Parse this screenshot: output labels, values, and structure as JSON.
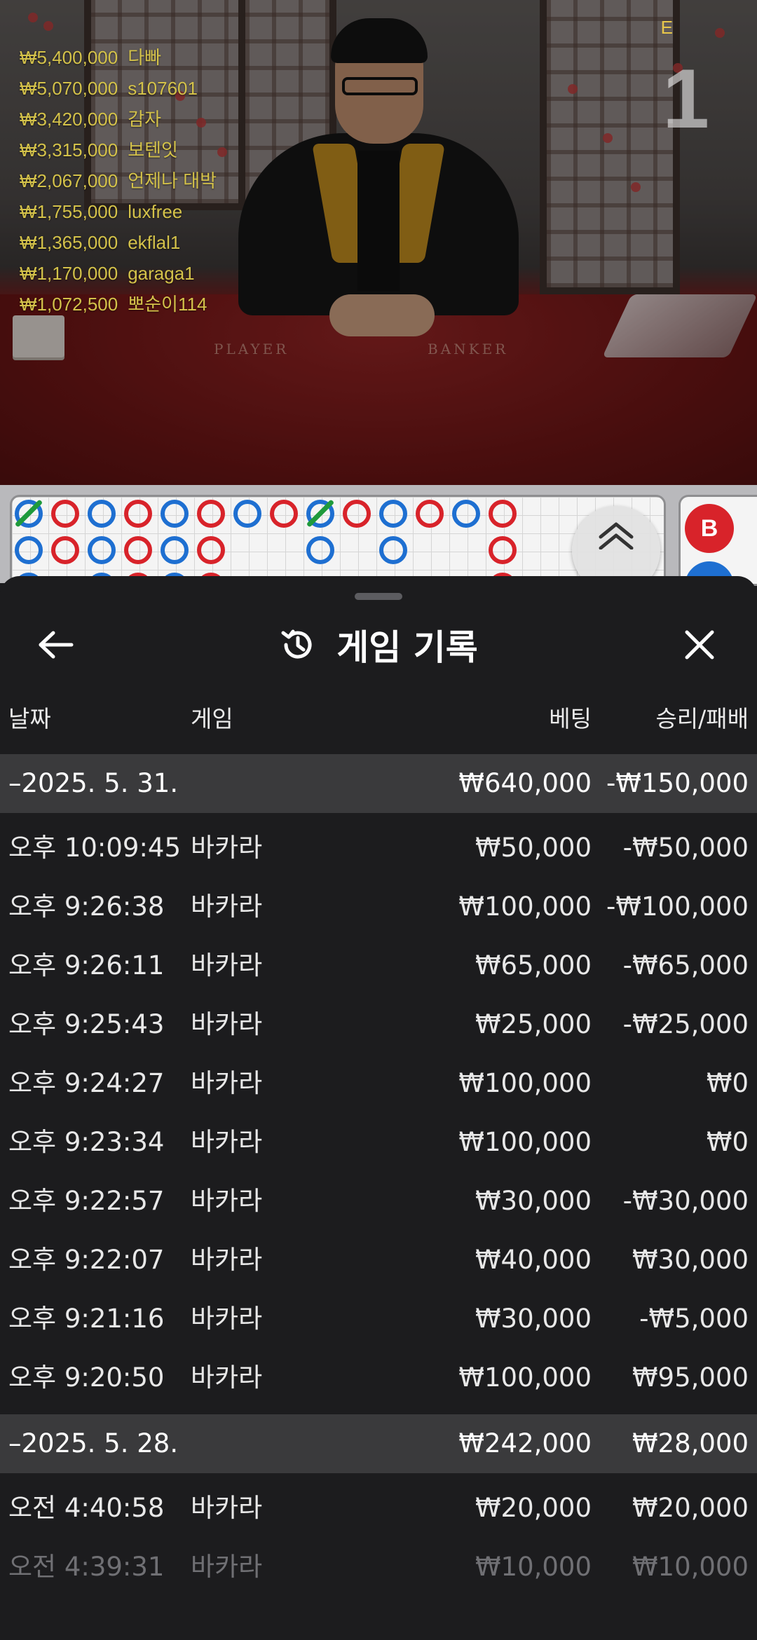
{
  "leaderboard": [
    {
      "amount": "₩5,400,000",
      "name": "다빠"
    },
    {
      "amount": "₩5,070,000",
      "name": "s107601"
    },
    {
      "amount": "₩3,420,000",
      "name": "감자"
    },
    {
      "amount": "₩3,315,000",
      "name": "보텐잇"
    },
    {
      "amount": "₩2,067,000",
      "name": "언제나 대박"
    },
    {
      "amount": "₩1,755,000",
      "name": "luxfree"
    },
    {
      "amount": "₩1,365,000",
      "name": "ekflal1"
    },
    {
      "amount": "₩1,170,000",
      "name": "garaga1"
    },
    {
      "amount": "₩1,072,500",
      "name": "뽀순이114"
    }
  ],
  "video": {
    "round_number": "1",
    "round_marker": "E",
    "felt_player": "PLAYER",
    "felt_banker": "BANKER"
  },
  "roadmap": {
    "side_beads": [
      "B",
      "P"
    ]
  },
  "sheet": {
    "title": "게임 기록",
    "columns": {
      "date": "날짜",
      "game": "게임",
      "bet": "베팅",
      "result": "승리/패배"
    },
    "groups": [
      {
        "date": "–2025. 5. 31.",
        "bet_total": "₩640,000",
        "result_total": "-₩150,000",
        "entries": [
          {
            "time": "오후 10:09:45",
            "game": "바카라",
            "bet": "₩50,000",
            "result": "-₩50,000"
          },
          {
            "time": "오후 9:26:38",
            "game": "바카라",
            "bet": "₩100,000",
            "result": "-₩100,000"
          },
          {
            "time": "오후 9:26:11",
            "game": "바카라",
            "bet": "₩65,000",
            "result": "-₩65,000"
          },
          {
            "time": "오후 9:25:43",
            "game": "바카라",
            "bet": "₩25,000",
            "result": "-₩25,000"
          },
          {
            "time": "오후 9:24:27",
            "game": "바카라",
            "bet": "₩100,000",
            "result": "₩0"
          },
          {
            "time": "오후 9:23:34",
            "game": "바카라",
            "bet": "₩100,000",
            "result": "₩0"
          },
          {
            "time": "오후 9:22:57",
            "game": "바카라",
            "bet": "₩30,000",
            "result": "-₩30,000"
          },
          {
            "time": "오후 9:22:07",
            "game": "바카라",
            "bet": "₩40,000",
            "result": "₩30,000"
          },
          {
            "time": "오후 9:21:16",
            "game": "바카라",
            "bet": "₩30,000",
            "result": "-₩5,000"
          },
          {
            "time": "오후 9:20:50",
            "game": "바카라",
            "bet": "₩100,000",
            "result": "₩95,000"
          }
        ]
      },
      {
        "date": "–2025. 5. 28.",
        "bet_total": "₩242,000",
        "result_total": "₩28,000",
        "entries": [
          {
            "time": "오전 4:40:58",
            "game": "바카라",
            "bet": "₩20,000",
            "result": "₩20,000"
          },
          {
            "time": "오전 4:39:31",
            "game": "바카라",
            "bet": "₩10,000",
            "result": "₩10,000"
          }
        ]
      }
    ]
  },
  "colors": {
    "sheet_bg": "#1c1c1e",
    "group_row_bg": "#3a3a3c",
    "leaderboard_text": "#d4c24a",
    "banker_red": "#d8232a",
    "player_blue": "#1e6fd1",
    "tie_green": "#1f9a3c"
  }
}
